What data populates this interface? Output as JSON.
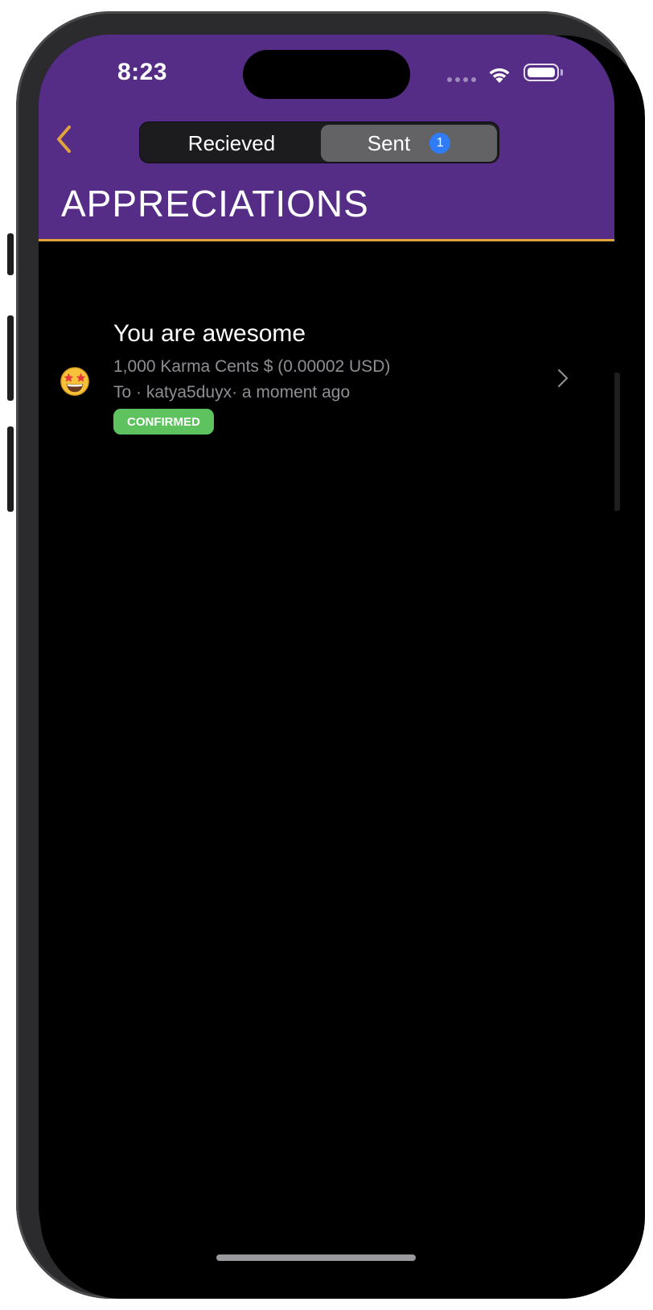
{
  "status_bar": {
    "time": "8:23"
  },
  "nav": {
    "back_icon": "chevron-left-icon",
    "segments": [
      {
        "label": "Recieved",
        "selected": false
      },
      {
        "label": "Sent",
        "selected": true,
        "badge": "1"
      }
    ]
  },
  "page": {
    "title": "APPRECIATIONS"
  },
  "appreciations": [
    {
      "emoji": "star-struck-emoji",
      "title": "You are awesome",
      "amount": "1,000 Karma Cents $ (0.00002 USD)",
      "meta": "To · katya5duyx· a moment ago",
      "status": "CONFIRMED",
      "status_color": "#5ec25f"
    }
  ],
  "colors": {
    "header_bg": "#552d86",
    "accent": "#e0a43a",
    "badge_blue": "#2f7cf6",
    "background": "#000000"
  }
}
